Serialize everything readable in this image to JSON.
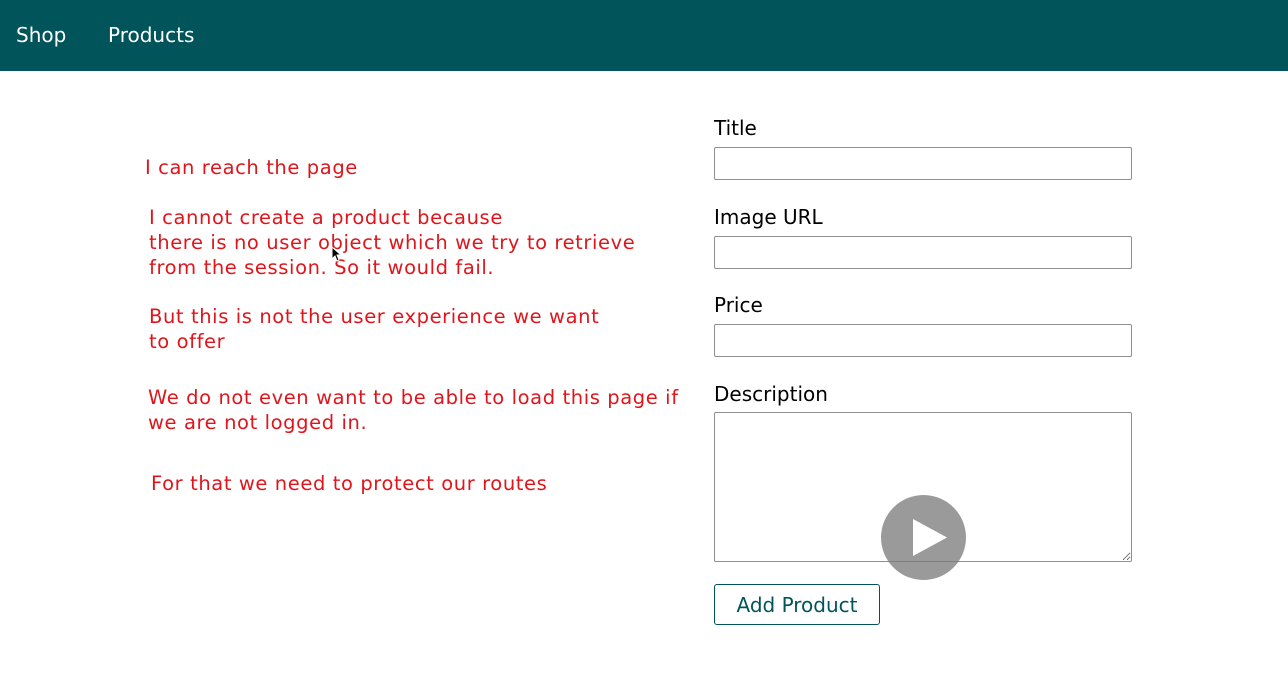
{
  "nav": {
    "shop_label": "Shop",
    "products_label": "Products"
  },
  "annotations": [
    "I can reach the page",
    "I cannot create a product because\nthere is no user object which we try to retrieve\nfrom the session. So it would fail.",
    "But this is not the user experience we want\nto offer",
    "We do not even want to be able to load this page if\nwe are not logged in.",
    "For that we need to protect our routes"
  ],
  "form": {
    "title_label": "Title",
    "title_value": "",
    "image_url_label": "Image URL",
    "image_url_value": "",
    "price_label": "Price",
    "price_value": "",
    "description_label": "Description",
    "description_value": "",
    "submit_label": "Add Product"
  },
  "video_overlay": {
    "icon": "play-icon"
  },
  "colors": {
    "header_bg": "#00545a",
    "annotation_text": "#e0151b",
    "button_text": "#00545a"
  }
}
